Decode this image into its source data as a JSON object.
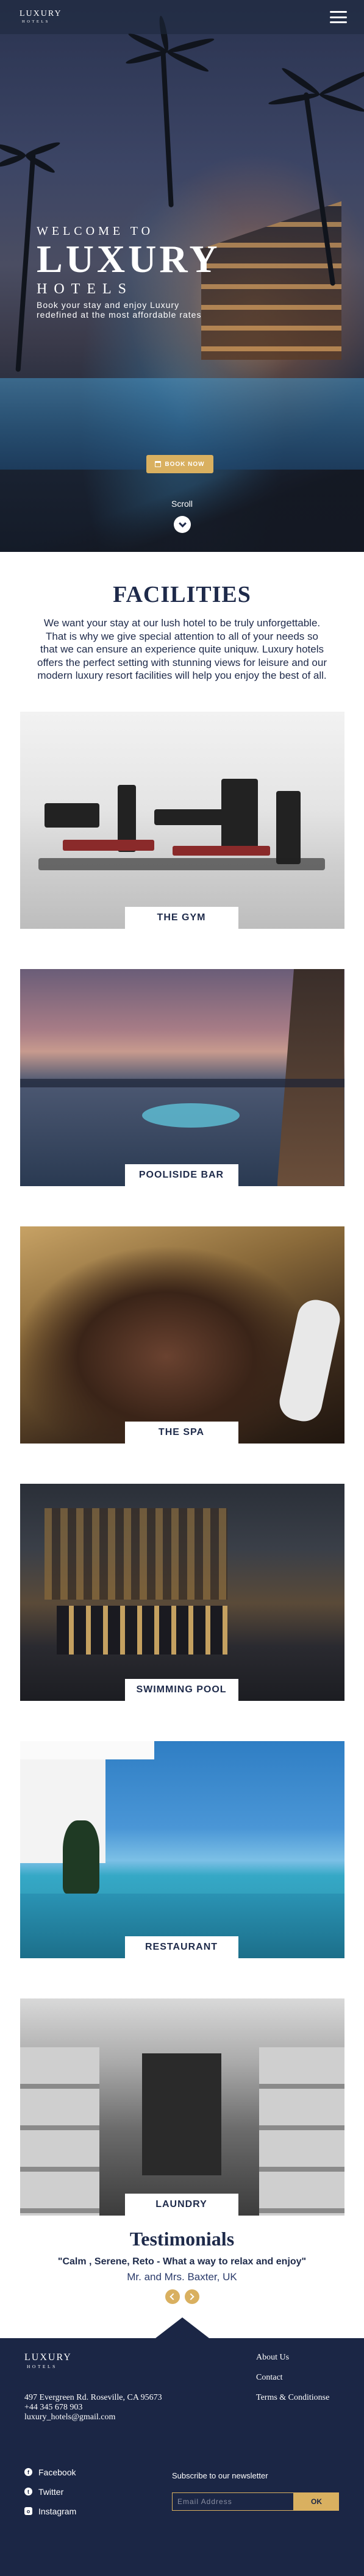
{
  "navbar": {
    "logo_line1": "LUXURY",
    "logo_line2": "HOTELS",
    "menu_icon": "hamburger-icon"
  },
  "hero": {
    "welcome": "WELCOME TO",
    "title": "LUXURY",
    "subtitle": "HOTELS",
    "tagline_line1": "Book your stay and enjoy Luxury",
    "tagline_line2": "redefined at the most affordable rates",
    "book_button": "BOOK NOW",
    "book_icon": "calendar-icon",
    "scroll_label": "Scroll",
    "scroll_icon": "chevron-down-icon"
  },
  "facilities": {
    "title": "FACILITIES",
    "description": "We want your stay at our lush hotel to be truly unforgettable. That is why we give special attention to all of your needs so that we can ensure an experience quite uniquw. Luxury hotels offers the perfect setting with stunning views for leisure and our modern luxury resort facilities will help you enjoy the best of all.",
    "items": [
      {
        "label": "THE GYM"
      },
      {
        "label": "POOLISIDE BAR"
      },
      {
        "label": "THE SPA"
      },
      {
        "label": "SWIMMING POOL"
      },
      {
        "label": "RESTAURANT"
      },
      {
        "label": "LAUNDRY"
      }
    ]
  },
  "testimonials": {
    "title": "Testimonials",
    "quote": "\"Calm , Serene, Reto - What a way to relax and enjoy\"",
    "author": "Mr. and Mrs. Baxter, UK"
  },
  "footer": {
    "logo_line1": "LUXURY",
    "logo_line2": "HOTELS",
    "address": "497 Evergreen Rd. Roseville, CA 95673",
    "phone": "+44 345 678 903",
    "email": "luxury_hotels@gmail.com",
    "links": [
      "About Us",
      "Contact",
      "Terms & Conditionse"
    ],
    "social": [
      {
        "label": "Facebook",
        "icon": "facebook-icon"
      },
      {
        "label": "Twitter",
        "icon": "twitter-icon"
      },
      {
        "label": "Instagram",
        "icon": "instagram-icon"
      }
    ],
    "newsletter_title": "Subscribe to our newsletter",
    "newsletter_placeholder": "Email Address",
    "newsletter_button": "OK"
  },
  "colors": {
    "navy": "#1e2a4a",
    "footer_bg": "#1b2645",
    "gold": "#d9b060"
  }
}
